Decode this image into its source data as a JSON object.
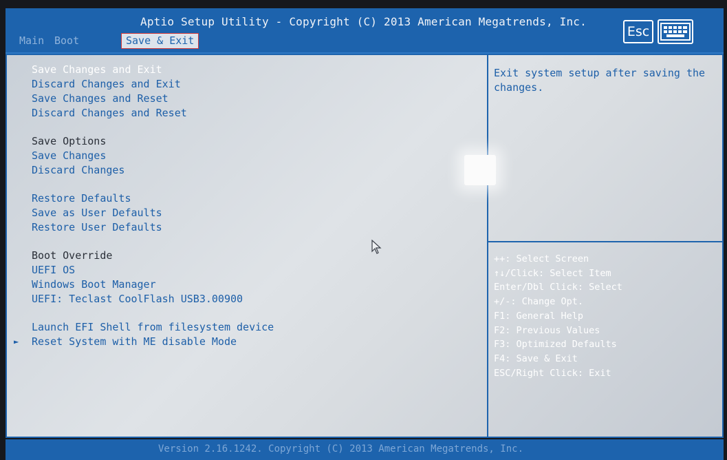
{
  "header": {
    "title": "Aptio Setup Utility - Copyright (C) 2013 American Megatrends, Inc.",
    "tabs": [
      {
        "label": "Main",
        "active": false
      },
      {
        "label": "Boot",
        "active": false
      },
      {
        "label": "Save & Exit",
        "active": true
      }
    ],
    "esc_label": "Esc",
    "keyboard_icon": "keyboard-icon"
  },
  "menu": {
    "items": [
      {
        "label": "Save Changes and Exit",
        "selected": true
      },
      {
        "label": "Discard Changes and Exit"
      },
      {
        "label": "Save Changes and Reset"
      },
      {
        "label": "Discard Changes and Reset"
      },
      {
        "label": "Save Options",
        "section": true
      },
      {
        "label": "Save Changes"
      },
      {
        "label": "Discard Changes"
      },
      {
        "label": "Restore Defaults"
      },
      {
        "label": "Save as User Defaults"
      },
      {
        "label": "Restore User Defaults"
      },
      {
        "label": "Boot Override",
        "section": true
      },
      {
        "label": "UEFI OS"
      },
      {
        "label": "Windows Boot Manager"
      },
      {
        "label": "UEFI: Teclast CoolFlash USB3.00900"
      },
      {
        "label": "Launch EFI Shell from filesystem device"
      },
      {
        "label": "Reset System with ME disable Mode",
        "submenu": true
      }
    ],
    "submenu_arrow": "►"
  },
  "help": {
    "description": "Exit system setup after saving the changes."
  },
  "keys": [
    "++: Select Screen",
    "↑↓/Click: Select Item",
    "Enter/Dbl Click: Select",
    "+/-: Change Opt.",
    "F1: General Help",
    "F2: Previous Values",
    "F3: Optimized Defaults",
    "F4: Save & Exit",
    "ESC/Right Click: Exit"
  ],
  "footer": {
    "text": "Version 2.16.1242. Copyright (C) 2013 American Megatrends, Inc."
  },
  "colors": {
    "accent_blue": "#1d63ad",
    "panel_gray": "#d9dde1",
    "selected_text": "#ffffff",
    "item_text": "#1d5fa8"
  }
}
